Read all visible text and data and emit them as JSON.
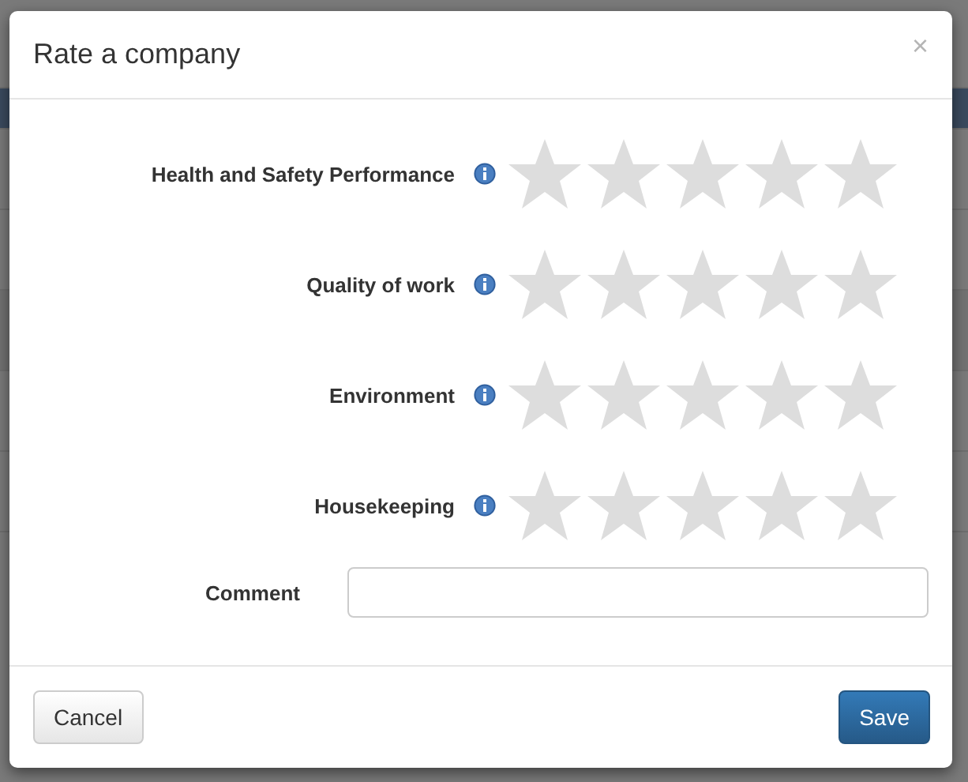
{
  "dialog": {
    "title": "Rate a company",
    "close": "×",
    "criteria": [
      {
        "label": "Health and Safety Performance",
        "stars": 0
      },
      {
        "label": "Quality of work",
        "stars": 0
      },
      {
        "label": "Environment",
        "stars": 0
      },
      {
        "label": "Housekeeping",
        "stars": 0
      }
    ],
    "comment": {
      "label": "Comment"
    },
    "buttons": [
      {
        "label": "Cancel",
        "kind": "default"
      },
      {
        "label": "Save",
        "kind": "primary"
      }
    ]
  }
}
